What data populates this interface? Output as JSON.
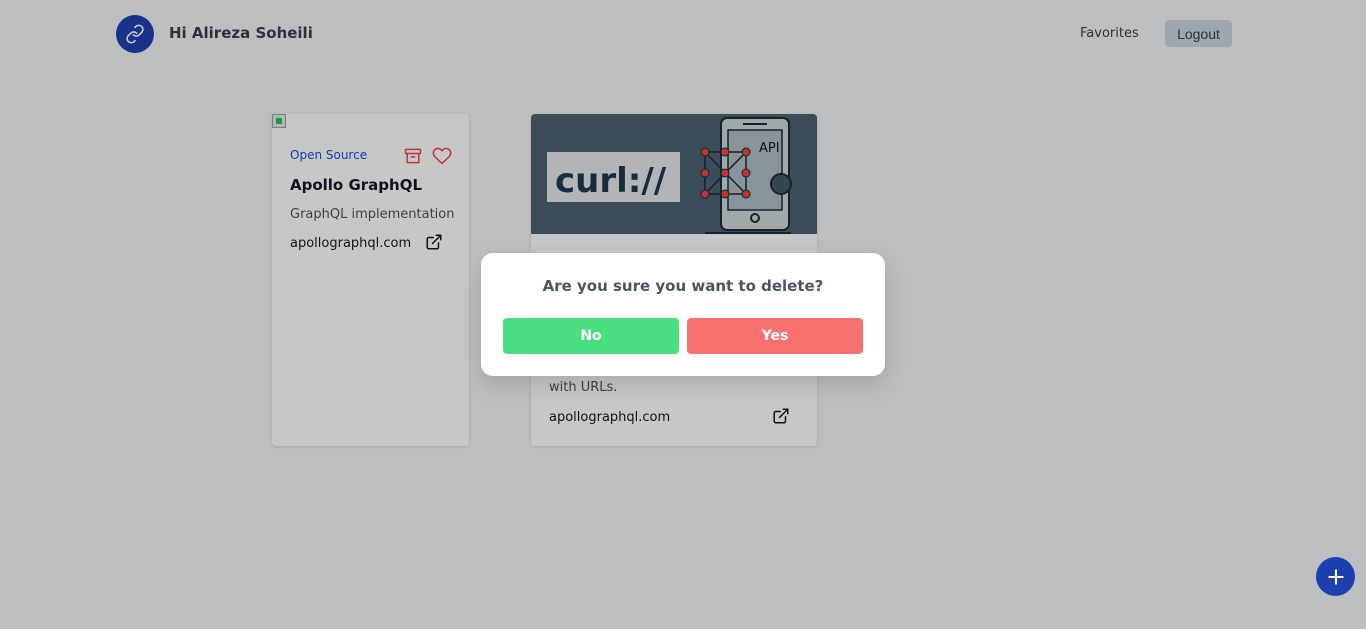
{
  "header": {
    "greeting": "Hi Alireza Soheili",
    "favorites_label": "Favorites",
    "logout_label": "Logout"
  },
  "cards": [
    {
      "tag": "Open Source",
      "title": "Apollo GraphQL",
      "description": "GraphQL implementation",
      "link": "apollographql.com"
    },
    {
      "image_text": "curl://",
      "image_badge": "API",
      "description": "with URLs.",
      "link": "apollographql.com"
    }
  ],
  "modal": {
    "message": "Are you sure you want to delete?",
    "no_label": "No",
    "yes_label": "Yes"
  },
  "colors": {
    "brand": "#1e40af",
    "no_button": "#4ade80",
    "yes_button": "#f87171",
    "tag": "#1d4ed8",
    "icon_red": "#ef4444"
  },
  "icons": {
    "logo": "link-icon",
    "archive": "archive-icon",
    "favorite": "heart-icon",
    "external": "external-link-icon",
    "fab": "plus-icon"
  }
}
